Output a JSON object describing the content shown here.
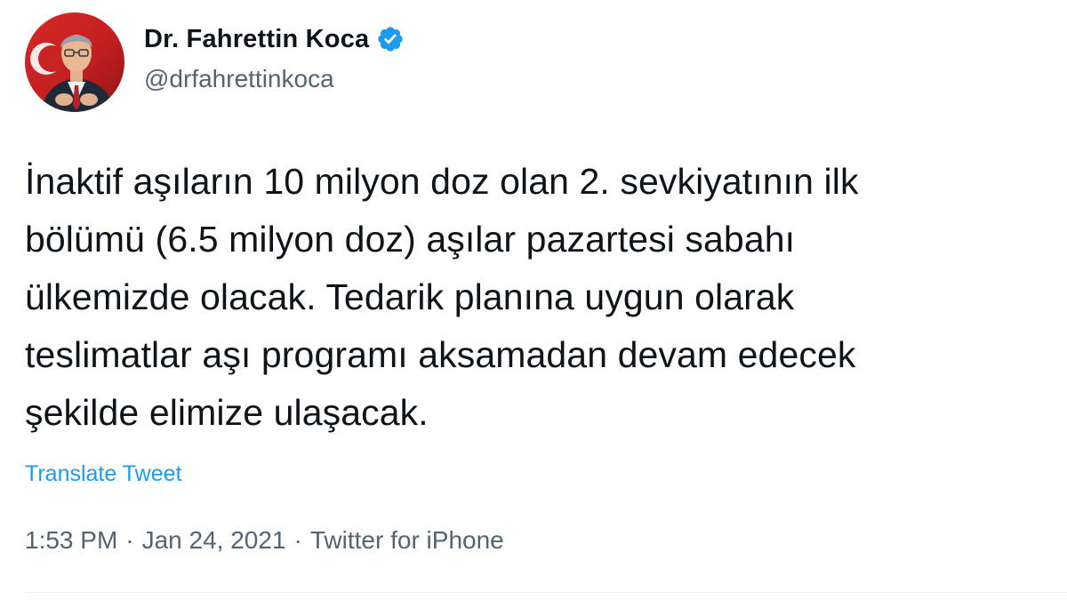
{
  "user": {
    "display_name": "Dr. Fahrettin Koca",
    "handle": "@drfahrettinkoca",
    "verified": true,
    "avatar_icon": "profile-photo"
  },
  "tweet": {
    "text": "İnaktif aşıların 10 milyon doz olan 2. sevkiyatının ilk\nbölümü (6.5 milyon doz) aşılar pazartesi sabahı\nülkemizde olacak. Tedarik planına uygun olarak\nteslimatlar aşı programı aksamadan devam edecek\nşekilde elimize ulaşacak.",
    "translate_label": "Translate Tweet"
  },
  "meta": {
    "time": "1:53 PM",
    "date": "Jan 24, 2021",
    "source": "Twitter for iPhone",
    "separator": "·"
  },
  "colors": {
    "text": "#0f1419",
    "secondary": "#536471",
    "link": "#1d9bf0",
    "verified": "#1d9bf0",
    "divider": "#eff3f4"
  }
}
